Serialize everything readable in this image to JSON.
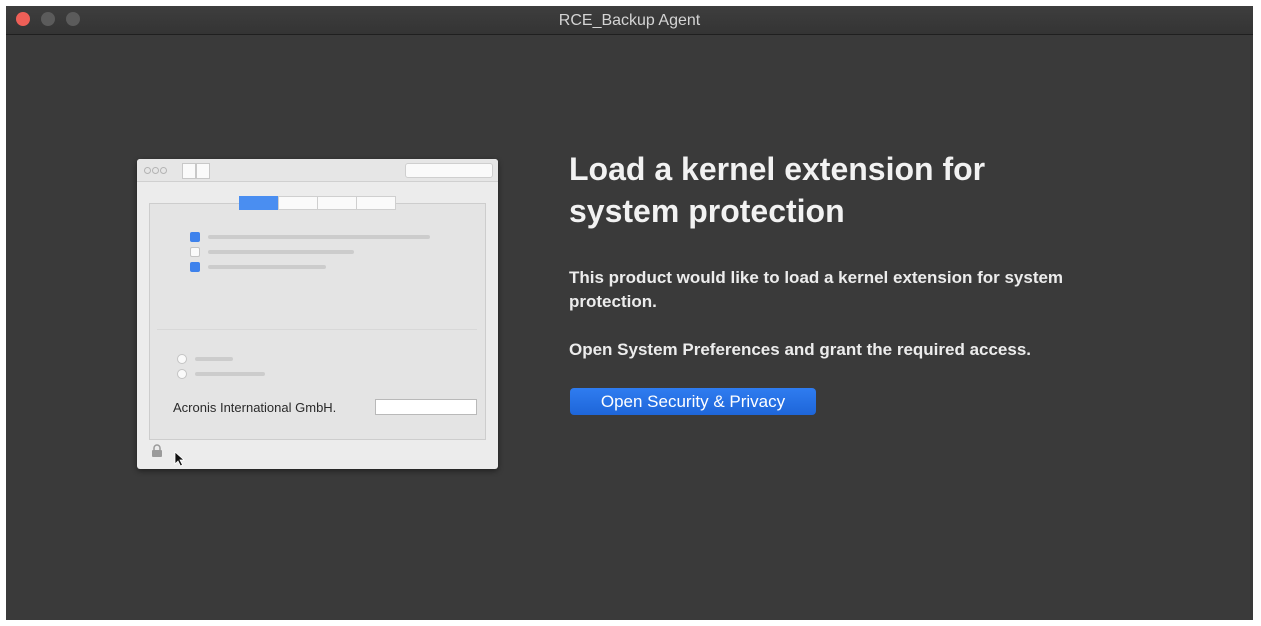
{
  "window": {
    "title": "RCE_Backup Agent"
  },
  "illustration": {
    "company": "Acronis International GmbH."
  },
  "main": {
    "heading": "Load a kernel extension for system protection",
    "description": "This product would like to load a kernel extension for system protection.",
    "hint": "Open System Preferences and grant the required access.",
    "button_label": "Open Security & Privacy"
  },
  "colors": {
    "accent": "#1e6ee0",
    "background": "#3a3a3a",
    "close": "#ee5f57"
  }
}
